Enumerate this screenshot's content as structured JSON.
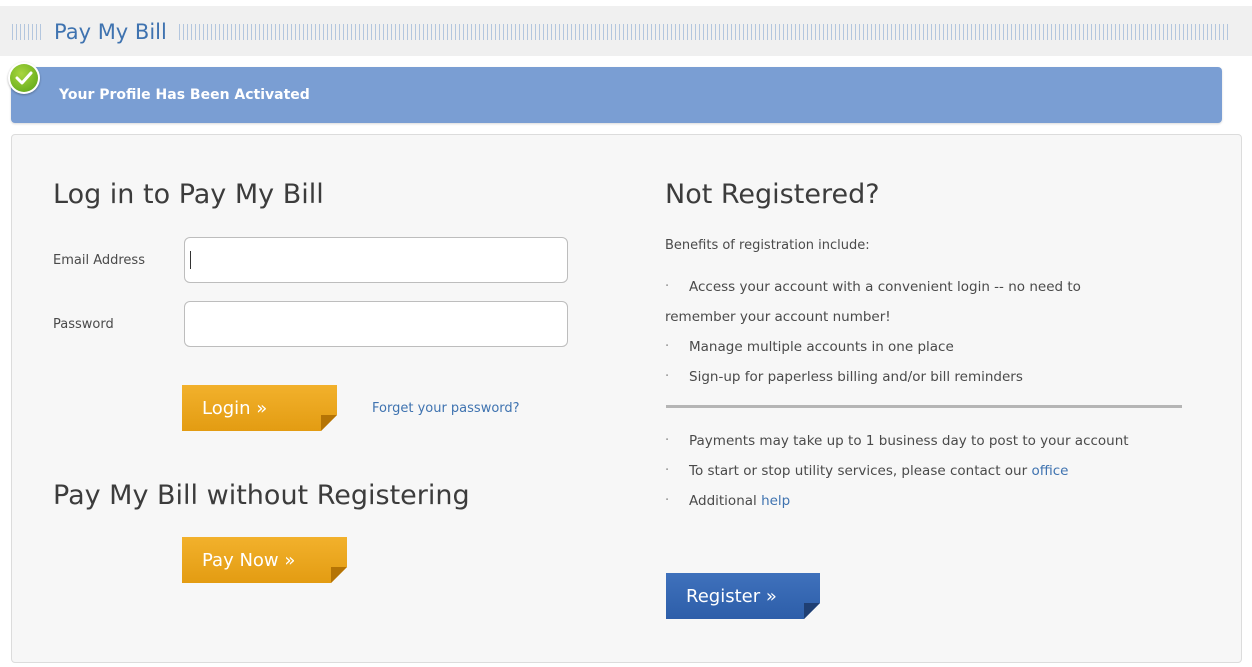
{
  "header": {
    "title": "Pay My Bill"
  },
  "banner": {
    "text": "Your Profile Has Been Activated",
    "status_color": "#7a9ed3",
    "icon": "check-icon"
  },
  "login": {
    "heading": "Log in to Pay My Bill",
    "email_label": "Email Address",
    "email_value": "",
    "password_label": "Password",
    "password_value": "",
    "login_button": "Login »",
    "forgot_link": "Forget your password?"
  },
  "pay_now": {
    "heading": "Pay My Bill without Registering",
    "button": "Pay Now »"
  },
  "register": {
    "heading": "Not Registered?",
    "intro": "Benefits of registration include:",
    "benefits": [
      "Access your account with a convenient login -- no need to",
      "remember your account number!",
      "Manage multiple accounts in one place",
      "Sign-up for paperless billing and/or bill reminders"
    ],
    "notes": [
      {
        "text": "Payments may take up to 1 business day to post to your account"
      },
      {
        "text": "To start or stop utility services, please contact our ",
        "link": "office"
      },
      {
        "text": "Additional ",
        "link": "help"
      }
    ],
    "button": "Register »"
  },
  "colors": {
    "accent_blue": "#3f73b0",
    "button_orange": "#e9a51c",
    "button_blue": "#3466b2"
  }
}
